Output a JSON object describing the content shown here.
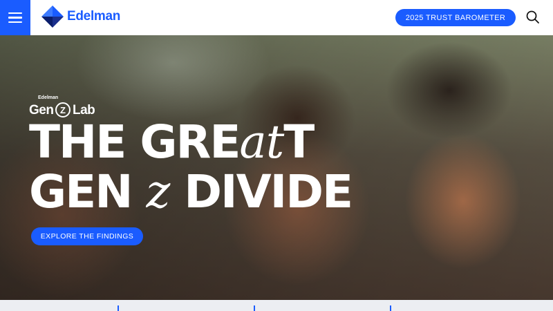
{
  "header": {
    "logo_text": "Edelman",
    "cta_label": "2025 TRUST BAROMETER",
    "menu_icon": "hamburger-icon",
    "search_icon": "search-icon"
  },
  "hero": {
    "lab_brand": "Edelman",
    "lab_gen": "Gen",
    "lab_z": "Z",
    "lab_lab": "Lab",
    "headline_line1_a": "THE GRE",
    "headline_line1_script": "at",
    "headline_line1_b": "T",
    "headline_line2_a": "GEN ",
    "headline_line2_script": "z",
    "headline_line2_b": " DIVIDE",
    "button_label": "EXPLORE THE FINDINGS"
  },
  "colors": {
    "accent": "#1a5cff",
    "strip_bg": "#eceef2"
  },
  "bottom_strip": {
    "items": [
      "",
      "",
      ""
    ]
  }
}
